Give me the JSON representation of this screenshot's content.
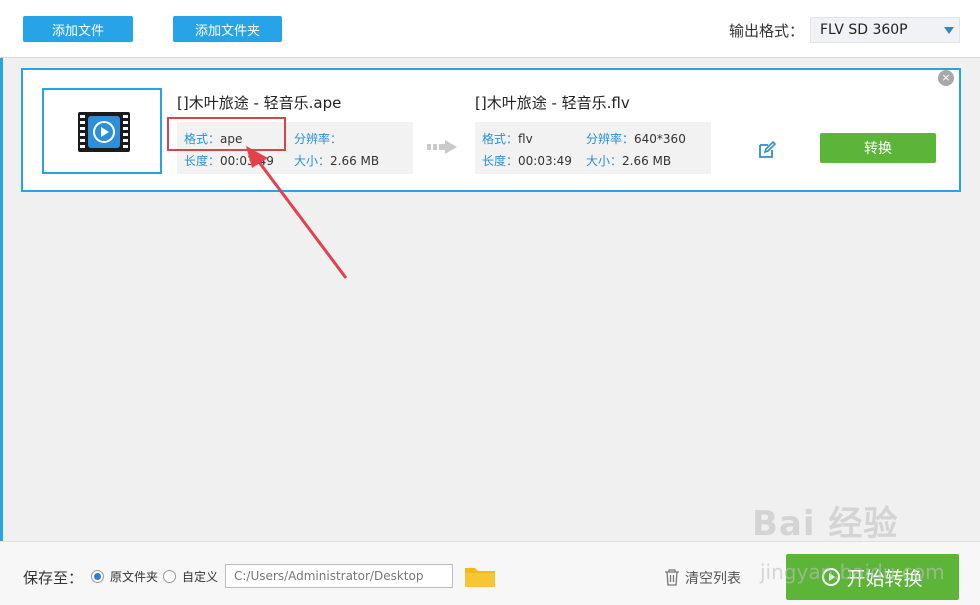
{
  "toolbar": {
    "add_file": "添加文件",
    "add_folder": "添加文件夹",
    "output_format_label": "输出格式：",
    "output_format_value": "FLV  SD 360P"
  },
  "task": {
    "source": {
      "name": "[]木叶旅途 - 轻音乐.ape",
      "format_key": "格式：",
      "format_val": "ape",
      "resolution_key": "分辨率：",
      "resolution_val": "",
      "duration_key": "长度：",
      "duration_val": "00:03:49",
      "size_key": "大小：",
      "size_val": "2.66 MB"
    },
    "target": {
      "name": "[]木叶旅途 - 轻音乐.flv",
      "format_key": "格式：",
      "format_val": "flv",
      "resolution_key": "分辨率：",
      "resolution_val": "640*360",
      "duration_key": "长度：",
      "duration_val": "00:03:49",
      "size_key": "大小：",
      "size_val": "2.66 MB"
    },
    "convert_label": "转换",
    "close_glyph": "×"
  },
  "footer": {
    "save_to_label": "保存至：",
    "radio_original": "原文件夹",
    "radio_custom": "自定义",
    "path_value": "C:/Users/Administrator/Desktop",
    "clear_list": "清空列表",
    "start_convert": "开始转换"
  },
  "watermark": {
    "line1": "Bai 经验",
    "line2": "jingyan.baidu.com"
  },
  "colors": {
    "accent_blue": "#27a3e8",
    "green": "#5cb539",
    "highlight_red": "#d8444a"
  }
}
